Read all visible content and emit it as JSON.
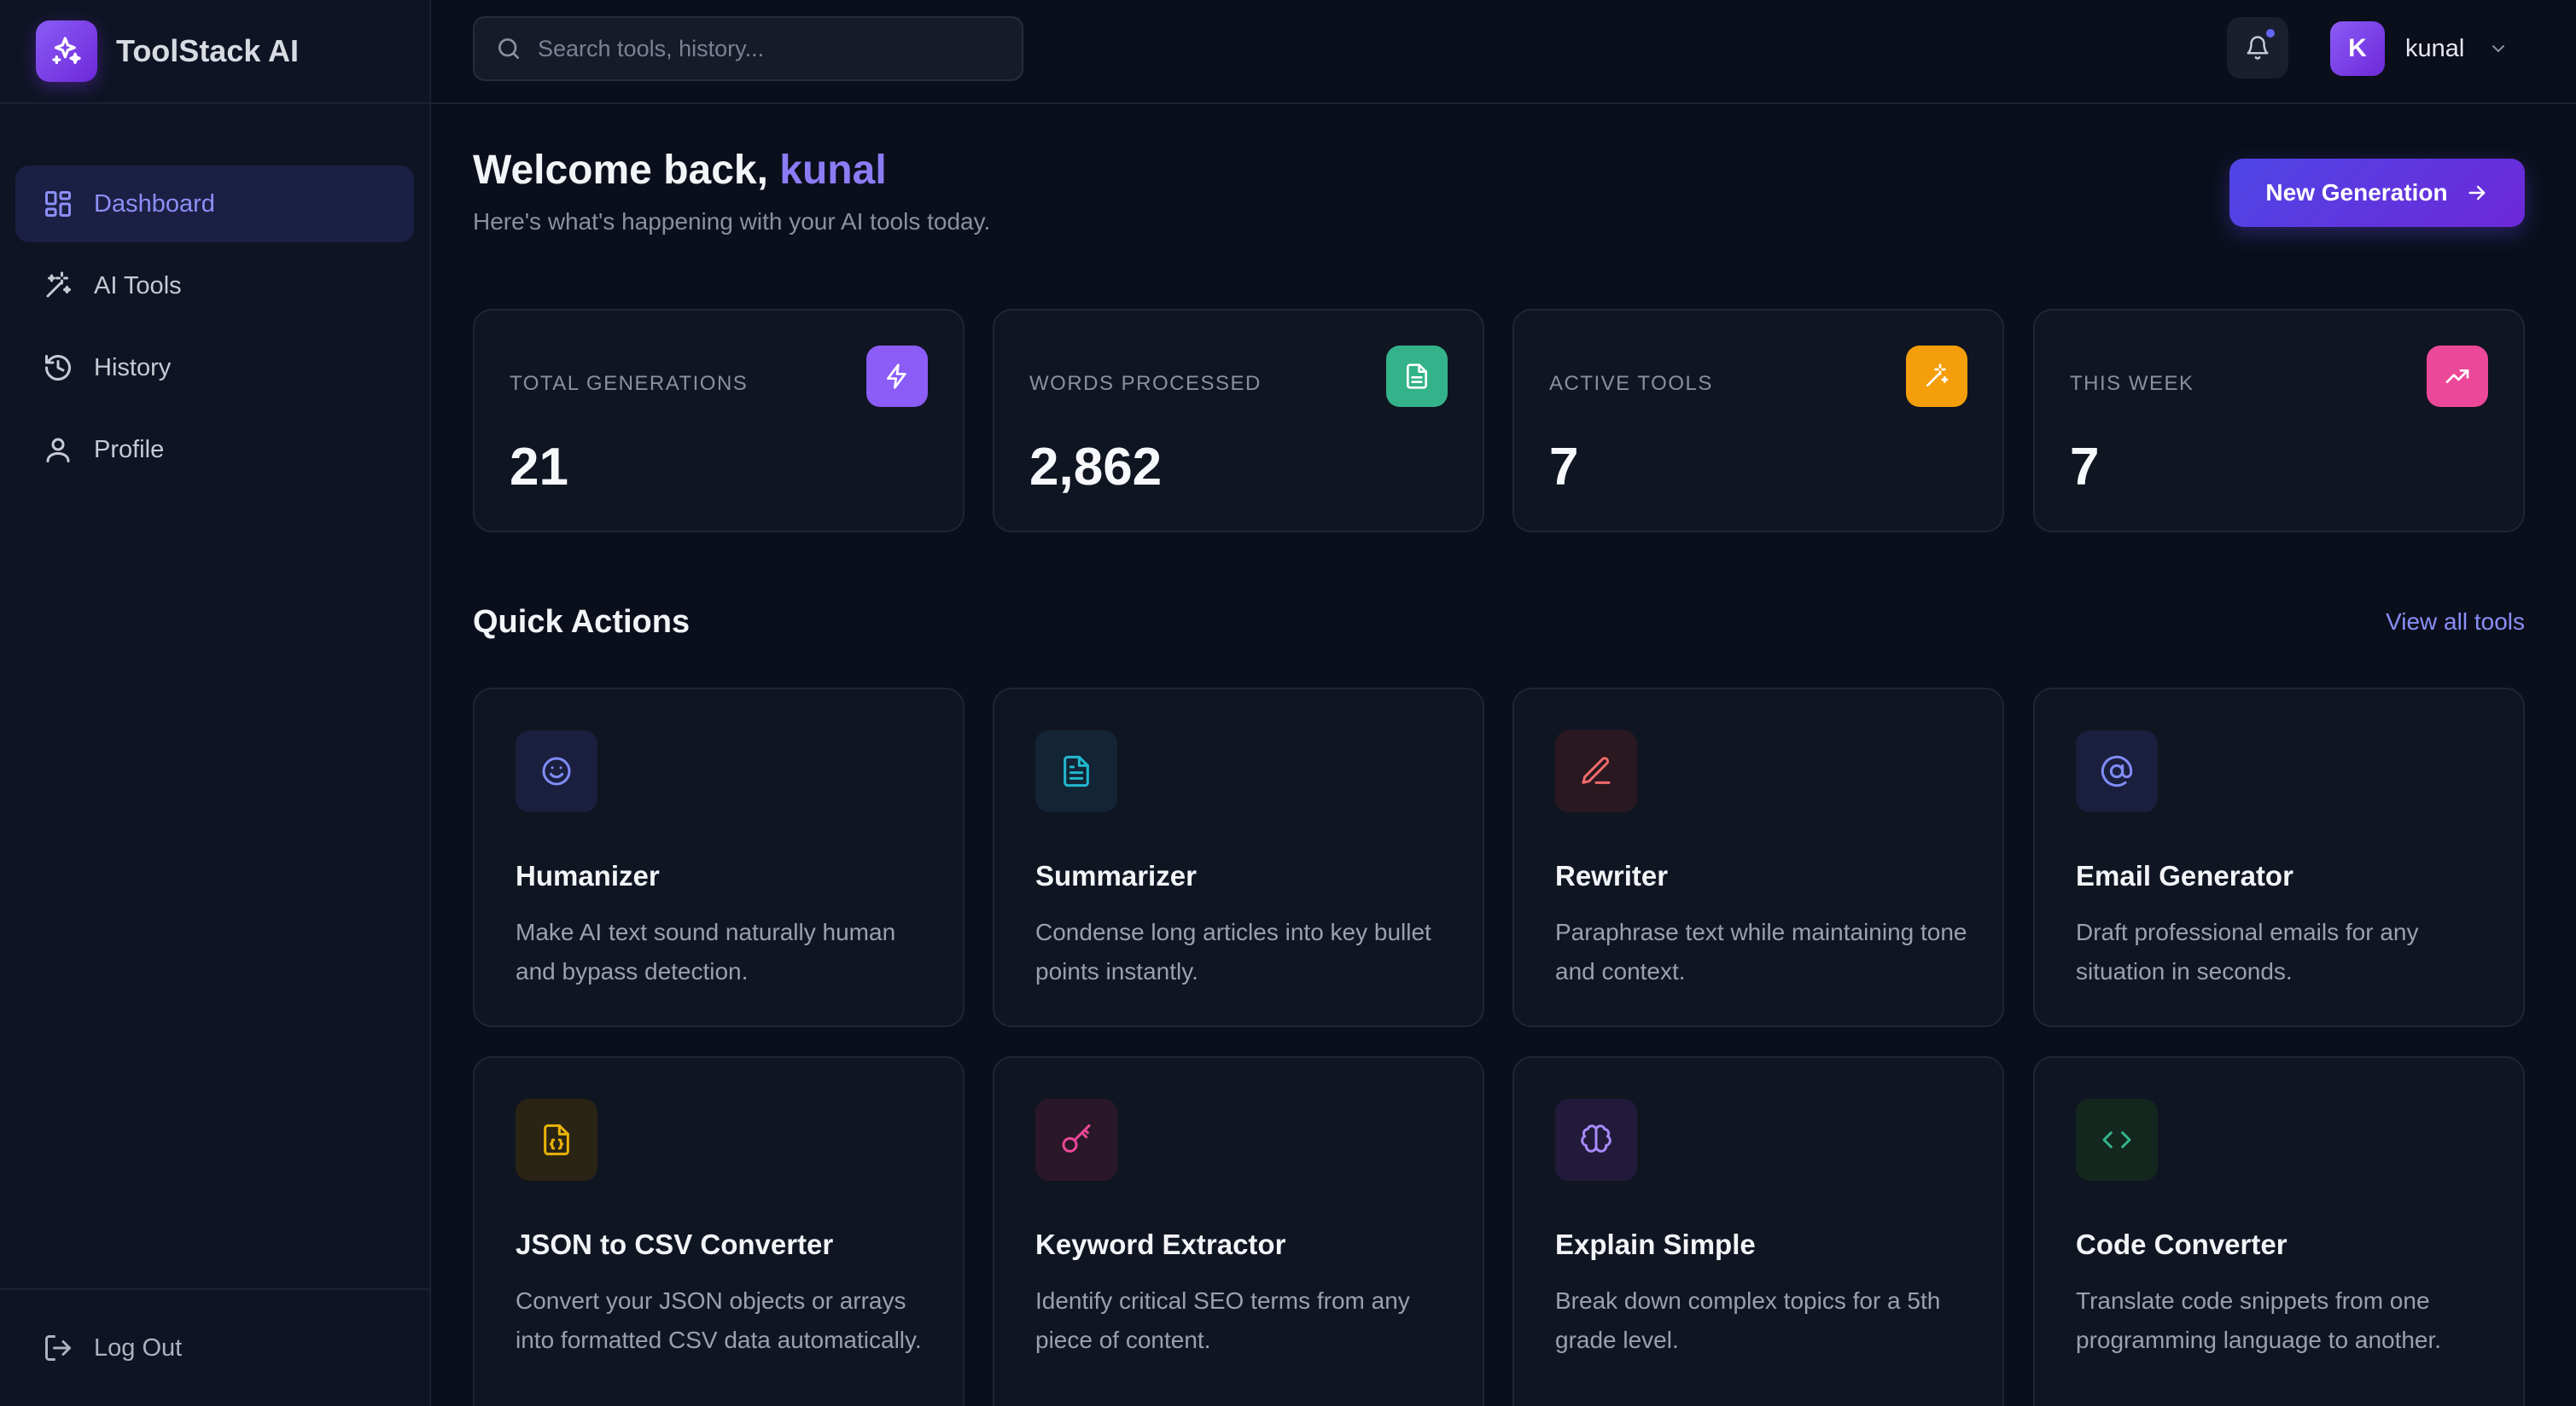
{
  "brand": {
    "name": "ToolStack AI",
    "logo_icon": "sparkles-icon",
    "accent": "#8b5cf6"
  },
  "sidebar": {
    "items": [
      {
        "label": "Dashboard",
        "icon": "dashboard-grid-icon",
        "active": true
      },
      {
        "label": "AI Tools",
        "icon": "magic-wand-icon",
        "active": false
      },
      {
        "label": "History",
        "icon": "history-icon",
        "active": false
      },
      {
        "label": "Profile",
        "icon": "user-icon",
        "active": false
      }
    ],
    "logout_label": "Log Out"
  },
  "topbar": {
    "search_placeholder": "Search tools, history...",
    "user_initial": "K",
    "user_name": "kunal"
  },
  "header": {
    "welcome_prefix": "Welcome back,",
    "welcome_name": "kunal",
    "subtitle": "Here's what's happening with your AI tools today.",
    "new_generation_label": "New Generation"
  },
  "stats": [
    {
      "label": "Total Generations",
      "value": "21",
      "icon": "lightning-icon",
      "color": "#8b5cf6"
    },
    {
      "label": "Words Processed",
      "value": "2,862",
      "icon": "document-icon",
      "color": "#34b38a"
    },
    {
      "label": "Active Tools",
      "value": "7",
      "icon": "magic-wand-icon",
      "color": "#f59e0b"
    },
    {
      "label": "This Week",
      "value": "7",
      "icon": "trending-up-icon",
      "color": "#ec4899"
    }
  ],
  "quick_actions": {
    "title": "Quick Actions",
    "view_all_label": "View all tools",
    "cards": [
      {
        "title": "Humanizer",
        "description": "Make AI text sound naturally human and bypass detection.",
        "icon": "smile-icon",
        "color": "#818cf8"
      },
      {
        "title": "Summarizer",
        "description": "Condense long articles into key bullet points instantly.",
        "icon": "document-text-icon",
        "color": "#22b8cf"
      },
      {
        "title": "Rewriter",
        "description": "Paraphrase text while maintaining tone and context.",
        "icon": "pencil-icon",
        "color": "#f06a6a"
      },
      {
        "title": "Email Generator",
        "description": "Draft professional emails for any situation in seconds.",
        "icon": "at-sign-icon",
        "color": "#818cf8"
      },
      {
        "title": "JSON to CSV Converter",
        "description": "Convert your JSON objects or arrays into formatted CSV data automatically.",
        "icon": "file-json-icon",
        "color": "#eab308"
      },
      {
        "title": "Keyword Extractor",
        "description": "Identify critical SEO terms from any piece of content.",
        "icon": "key-icon",
        "color": "#ec4899"
      },
      {
        "title": "Explain Simple",
        "description": "Break down complex topics for a 5th grade level.",
        "icon": "brain-icon",
        "color": "#a78bfa"
      },
      {
        "title": "Code Converter",
        "description": "Translate code snippets from one programming language to another.",
        "icon": "code-icon",
        "color": "#34b38a"
      }
    ]
  }
}
